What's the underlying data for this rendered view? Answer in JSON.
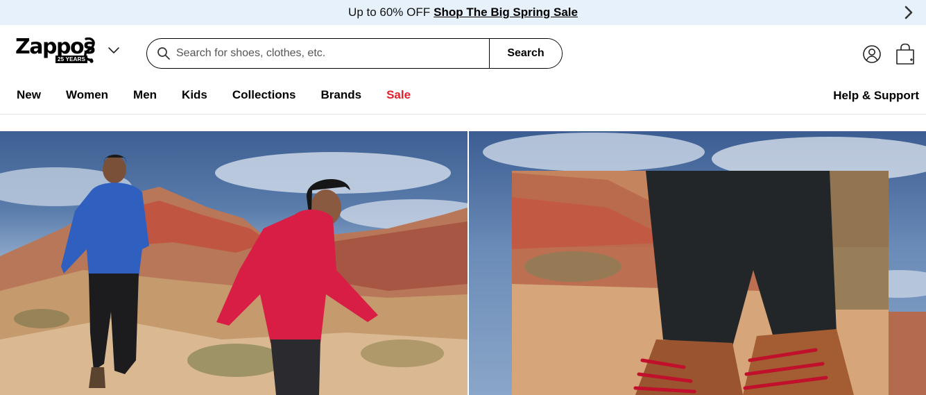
{
  "promo": {
    "lead": "Up to 60% OFF",
    "link": "Shop The Big Spring Sale",
    "next_icon": "chevron-right-icon"
  },
  "header": {
    "logo_text": "Zappos",
    "logo_badge": "25 YEARS",
    "logo_menu_icon": "chevron-down-icon",
    "search": {
      "placeholder": "Search for shoes, clothes, etc.",
      "button": "Search",
      "icon": "search-icon"
    },
    "account_icon": "user-circle-icon",
    "cart_icon": "shopping-bag-icon"
  },
  "nav": {
    "items": [
      {
        "label": "New"
      },
      {
        "label": "Women"
      },
      {
        "label": "Men"
      },
      {
        "label": "Kids"
      },
      {
        "label": "Collections"
      },
      {
        "label": "Brands"
      },
      {
        "label": "Sale"
      }
    ],
    "help": "Help & Support"
  },
  "colors": {
    "promo_bg": "#e6f1fb",
    "sale": "#e61e2a",
    "text": "#000000"
  }
}
